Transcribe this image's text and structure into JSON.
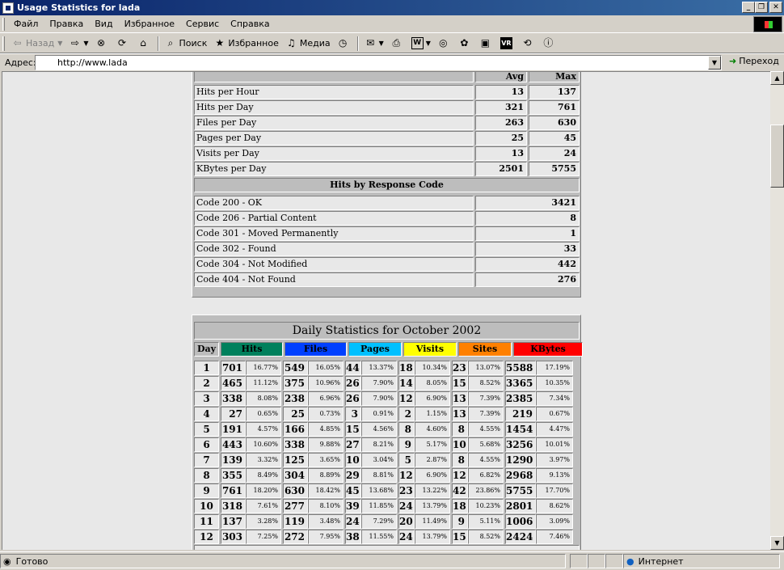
{
  "window": {
    "title": "Usage Statistics for lada"
  },
  "menu": [
    "Файл",
    "Правка",
    "Вид",
    "Избранное",
    "Сервис",
    "Справка"
  ],
  "toolbar": {
    "back": "Назад",
    "search": "Поиск",
    "favorites": "Избранное",
    "media": "Медиа"
  },
  "address": {
    "label": "Адрес:",
    "url": "http://www.lada",
    "go": "Переход"
  },
  "status": {
    "text": "Готово",
    "zone": "Интернет"
  },
  "summary": {
    "headers": {
      "avg": "Avg",
      "max": "Max"
    },
    "rows": [
      {
        "label": "Hits per Hour",
        "avg": "13",
        "max": "137"
      },
      {
        "label": "Hits per Day",
        "avg": "321",
        "max": "761"
      },
      {
        "label": "Files per Day",
        "avg": "263",
        "max": "630"
      },
      {
        "label": "Pages per Day",
        "avg": "25",
        "max": "45"
      },
      {
        "label": "Visits per Day",
        "avg": "13",
        "max": "24"
      },
      {
        "label": "KBytes per Day",
        "avg": "2501",
        "max": "5755"
      }
    ],
    "response_title": "Hits by Response Code",
    "codes": [
      {
        "label": "Code 200 - OK",
        "value": "3421"
      },
      {
        "label": "Code 206 - Partial Content",
        "value": "8"
      },
      {
        "label": "Code 301 - Moved Permanently",
        "value": "1"
      },
      {
        "label": "Code 302 - Found",
        "value": "33"
      },
      {
        "label": "Code 304 - Not Modified",
        "value": "442"
      },
      {
        "label": "Code 404 - Not Found",
        "value": "276"
      }
    ]
  },
  "daily": {
    "title": "Daily Statistics for October 2002",
    "columns": [
      {
        "label": "Day",
        "color": "#bdbdbd",
        "text": "#000000"
      },
      {
        "label": "Hits",
        "color": "#00805c",
        "text": "#000000"
      },
      {
        "label": "Files",
        "color": "#0040ff",
        "text": "#000000"
      },
      {
        "label": "Pages",
        "color": "#00c0ff",
        "text": "#000000"
      },
      {
        "label": "Visits",
        "color": "#ffff00",
        "text": "#000000"
      },
      {
        "label": "Sites",
        "color": "#ff8000",
        "text": "#000000"
      },
      {
        "label": "KBytes",
        "color": "#ff0000",
        "text": "#000000"
      }
    ],
    "rows": [
      [
        "1",
        "701",
        "16.77%",
        "549",
        "16.05%",
        "44",
        "13.37%",
        "18",
        "10.34%",
        "23",
        "13.07%",
        "5588",
        "17.19%"
      ],
      [
        "2",
        "465",
        "11.12%",
        "375",
        "10.96%",
        "26",
        "7.90%",
        "14",
        "8.05%",
        "15",
        "8.52%",
        "3365",
        "10.35%"
      ],
      [
        "3",
        "338",
        "8.08%",
        "238",
        "6.96%",
        "26",
        "7.90%",
        "12",
        "6.90%",
        "13",
        "7.39%",
        "2385",
        "7.34%"
      ],
      [
        "4",
        "27",
        "0.65%",
        "25",
        "0.73%",
        "3",
        "0.91%",
        "2",
        "1.15%",
        "13",
        "7.39%",
        "219",
        "0.67%"
      ],
      [
        "5",
        "191",
        "4.57%",
        "166",
        "4.85%",
        "15",
        "4.56%",
        "8",
        "4.60%",
        "8",
        "4.55%",
        "1454",
        "4.47%"
      ],
      [
        "6",
        "443",
        "10.60%",
        "338",
        "9.88%",
        "27",
        "8.21%",
        "9",
        "5.17%",
        "10",
        "5.68%",
        "3256",
        "10.01%"
      ],
      [
        "7",
        "139",
        "3.32%",
        "125",
        "3.65%",
        "10",
        "3.04%",
        "5",
        "2.87%",
        "8",
        "4.55%",
        "1290",
        "3.97%"
      ],
      [
        "8",
        "355",
        "8.49%",
        "304",
        "8.89%",
        "29",
        "8.81%",
        "12",
        "6.90%",
        "12",
        "6.82%",
        "2968",
        "9.13%"
      ],
      [
        "9",
        "761",
        "18.20%",
        "630",
        "18.42%",
        "45",
        "13.68%",
        "23",
        "13.22%",
        "42",
        "23.86%",
        "5755",
        "17.70%"
      ],
      [
        "10",
        "318",
        "7.61%",
        "277",
        "8.10%",
        "39",
        "11.85%",
        "24",
        "13.79%",
        "18",
        "10.23%",
        "2801",
        "8.62%"
      ],
      [
        "11",
        "137",
        "3.28%",
        "119",
        "3.48%",
        "24",
        "7.29%",
        "20",
        "11.49%",
        "9",
        "5.11%",
        "1006",
        "3.09%"
      ],
      [
        "12",
        "303",
        "7.25%",
        "272",
        "7.95%",
        "38",
        "11.55%",
        "24",
        "13.79%",
        "15",
        "8.52%",
        "2424",
        "7.46%"
      ]
    ]
  }
}
